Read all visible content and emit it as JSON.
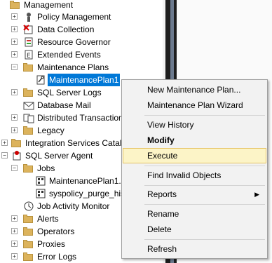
{
  "tree": {
    "management": "Management",
    "policy_management": "Policy Management",
    "data_collection": "Data Collection",
    "resource_governor": "Resource Governor",
    "extended_events": "Extended Events",
    "maintenance_plans": "Maintenance Plans",
    "maintenance_plan1": "MaintenancePlan1",
    "sql_server_logs": "SQL Server Logs",
    "database_mail": "Database Mail",
    "distributed_transaction": "Distributed Transaction",
    "legacy": "Legacy",
    "integration_services": "Integration Services Catalog",
    "sql_server_agent": "SQL Server Agent",
    "jobs": "Jobs",
    "job1": "MaintenancePlan1.S",
    "job2": "syspolicy_purge_his",
    "job_activity_monitor": "Job Activity Monitor",
    "alerts": "Alerts",
    "operators": "Operators",
    "proxies": "Proxies",
    "error_logs": "Error Logs"
  },
  "context_menu": {
    "new_plan": "New Maintenance Plan...",
    "wizard": "Maintenance Plan Wizard",
    "view_history": "View History",
    "modify": "Modify",
    "execute": "Execute",
    "find_invalid": "Find Invalid Objects",
    "reports": "Reports",
    "rename": "Rename",
    "delete": "Delete",
    "refresh": "Refresh"
  },
  "colors": {
    "selection": "#0078d7",
    "highlight_bg": "#fcf4c7",
    "highlight_border": "#e5c365"
  }
}
